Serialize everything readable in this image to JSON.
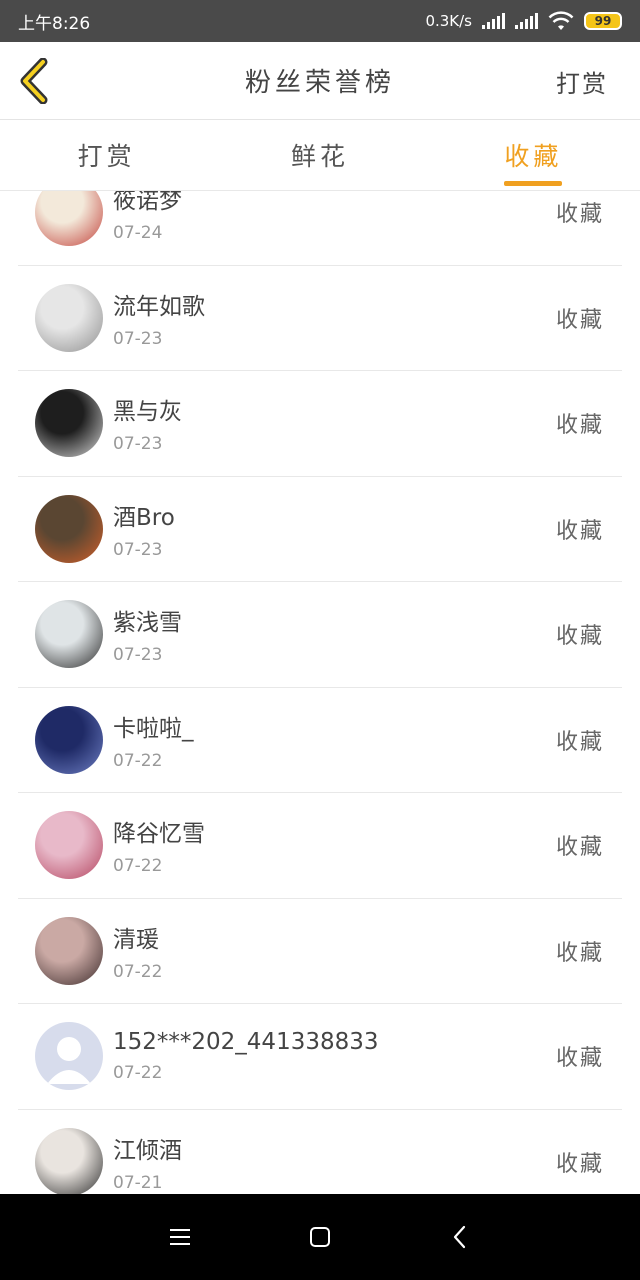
{
  "status_bar": {
    "time": "上午8:26",
    "network_speed": "0.3K/s",
    "battery": "99"
  },
  "header": {
    "title": "粉丝荣誉榜",
    "action_label": "打赏"
  },
  "tabs": [
    {
      "label": "打赏",
      "active": false
    },
    {
      "label": "鲜花",
      "active": false
    },
    {
      "label": "收藏",
      "active": true
    }
  ],
  "colors": {
    "accent": "#f0a020",
    "status_bar": "#4a4a4a",
    "nav_bar": "#000000"
  },
  "rows": [
    {
      "name": "筱诺梦",
      "date": "07-24",
      "action": "收藏",
      "avatar_colors": [
        "#f3e9da",
        "#c2423b"
      ]
    },
    {
      "name": "流年如歌",
      "date": "07-23",
      "action": "收藏",
      "avatar_colors": [
        "#e6e6e6",
        "#8f8f8f"
      ]
    },
    {
      "name": "黑与灰",
      "date": "07-23",
      "action": "收藏",
      "avatar_colors": [
        "#1e1e1e",
        "#d9d9d9"
      ]
    },
    {
      "name": "酒Bro",
      "date": "07-23",
      "action": "收藏",
      "avatar_colors": [
        "#5a4632",
        "#d2602a"
      ]
    },
    {
      "name": "紫浅雪",
      "date": "07-23",
      "action": "收藏",
      "avatar_colors": [
        "#dfe4e6",
        "#2a2a2a"
      ]
    },
    {
      "name": "卡啦啦_",
      "date": "07-22",
      "action": "收藏",
      "avatar_colors": [
        "#1f2a66",
        "#6e7fc4"
      ]
    },
    {
      "name": "降谷忆雪",
      "date": "07-22",
      "action": "收藏",
      "avatar_colors": [
        "#e8b9c9",
        "#b4445f"
      ]
    },
    {
      "name": "清瑗",
      "date": "07-22",
      "action": "收藏",
      "avatar_colors": [
        "#caa9a4",
        "#3b2a2a"
      ]
    },
    {
      "name": "152***202_441338833",
      "date": "07-22",
      "action": "收藏",
      "avatar_colors": [
        "#d7dcec",
        "#ffffff"
      ]
    },
    {
      "name": "江倾酒",
      "date": "07-21",
      "action": "收藏",
      "avatar_colors": [
        "#e9e4df",
        "#2b2b2b"
      ]
    }
  ]
}
